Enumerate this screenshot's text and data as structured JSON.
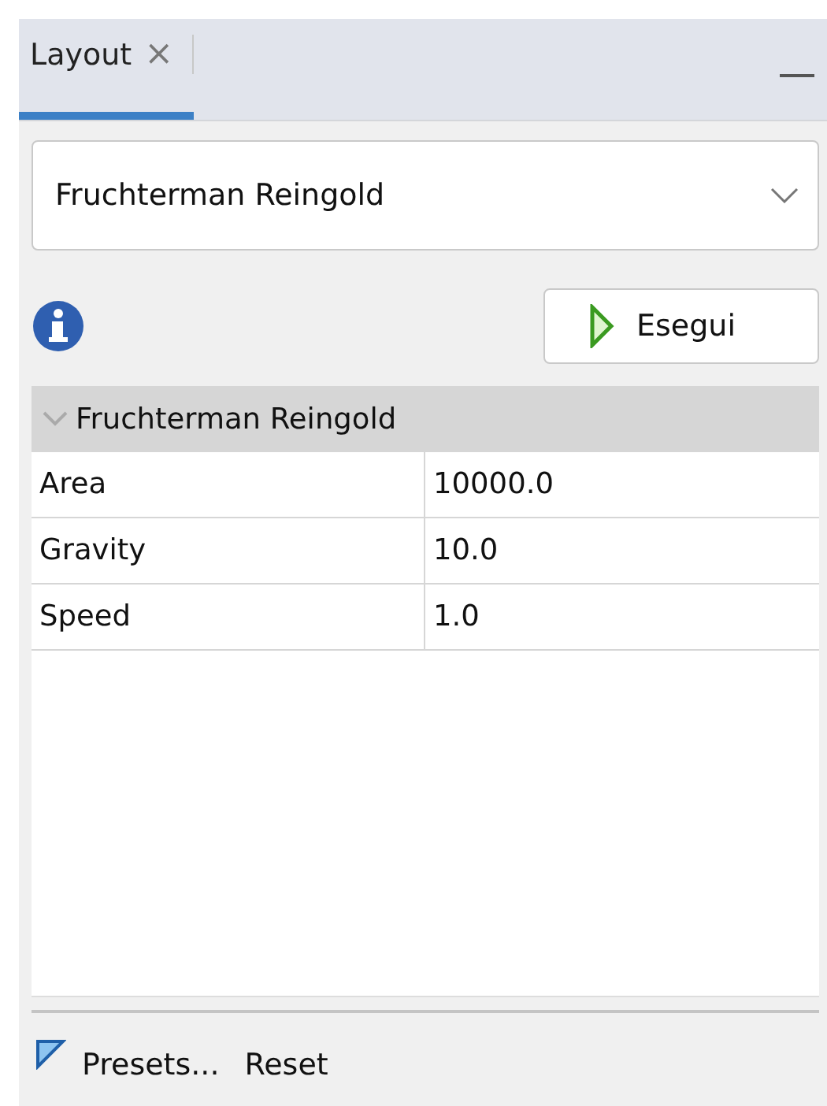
{
  "tab": {
    "label": "Layout",
    "close": "×",
    "selected": true
  },
  "algorithm": {
    "value": "Fruchterman Reingold"
  },
  "run_button": {
    "label": "Esegui"
  },
  "properties": {
    "group": {
      "label": "Fruchterman Reingold",
      "expanded": true
    },
    "rows": [
      {
        "name": "Area",
        "value": "10000.0"
      },
      {
        "name": "Gravity",
        "value": "10.0"
      },
      {
        "name": "Speed",
        "value": "1.0"
      }
    ]
  },
  "footer": {
    "presets": "Presets...",
    "reset": "Reset"
  }
}
